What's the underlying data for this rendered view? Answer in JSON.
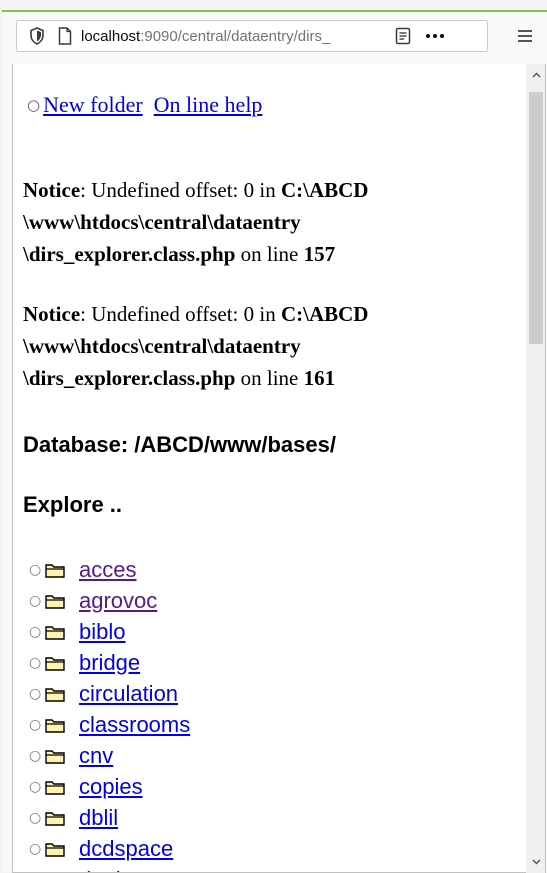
{
  "browser": {
    "url_host": "localhost",
    "url_rest": ":9090/central/dataentry/dirs_"
  },
  "links": {
    "new_folder": "New folder",
    "online_help": "On line help"
  },
  "notices": [
    {
      "label": "Notice",
      "text": ": Undefined offset: 0 in ",
      "path_line1": "C:\\ABCD",
      "path_line2": "\\www\\htdocs\\central\\dataentry",
      "path_line3": "\\dirs_explorer.class.php",
      "on_line": " on line ",
      "line_number": "157"
    },
    {
      "label": "Notice",
      "text": ": Undefined offset: 0 in ",
      "path_line1": "C:\\ABCD",
      "path_line2": "\\www\\htdocs\\central\\dataentry",
      "path_line3": "\\dirs_explorer.class.php",
      "on_line": " on line ",
      "line_number": "161"
    }
  ],
  "database_heading": "Database: /ABCD/www/bases/",
  "explore_heading": "Explore ..",
  "folders": [
    {
      "name": "acces",
      "visited": true
    },
    {
      "name": "agrovoc",
      "visited": true
    },
    {
      "name": "biblo",
      "visited": false
    },
    {
      "name": "bridge",
      "visited": false
    },
    {
      "name": "circulation",
      "visited": false
    },
    {
      "name": "classrooms",
      "visited": false
    },
    {
      "name": "cnv",
      "visited": false
    },
    {
      "name": "copies",
      "visited": false
    },
    {
      "name": "dblil",
      "visited": false
    },
    {
      "name": "dcdspace",
      "visited": false
    },
    {
      "name": "doaj",
      "visited": false
    }
  ],
  "colors": {
    "link": "#0000ee",
    "visited_link": "#551a8b",
    "folder_fill": "#fff3b0",
    "accent_top": "#86c04a"
  }
}
